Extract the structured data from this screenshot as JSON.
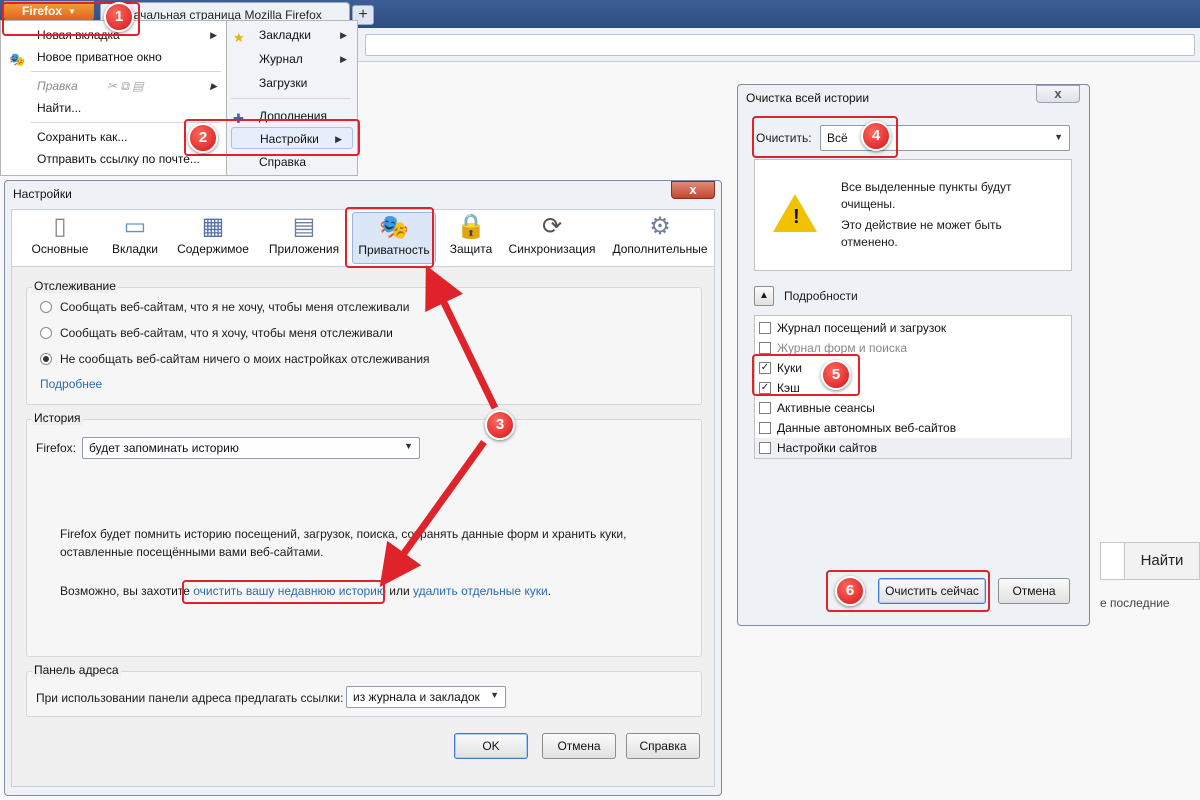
{
  "browser": {
    "menu_button": "Firefox",
    "tab_title": "Начальная страница Mozilla Firefox",
    "new_tab_symbol": "+"
  },
  "firefox_menu": {
    "left_items": [
      {
        "label": "Новая вкладка",
        "arrow": true
      },
      {
        "label": "Новое приватное окно"
      },
      {
        "label": "Правка",
        "disabled": true,
        "arrow": true
      },
      {
        "label": "Найти..."
      },
      {
        "label": "Сохранить как..."
      },
      {
        "label": "Отправить ссылку по почте..."
      }
    ],
    "right_items": [
      {
        "label": "Закладки",
        "arrow": true
      },
      {
        "label": "Журнал",
        "arrow": true
      },
      {
        "label": "Загрузки"
      },
      {
        "label": "Дополнения"
      },
      {
        "label": "Настройки",
        "arrow": true,
        "highlighted": true
      },
      {
        "label": "Справка"
      }
    ]
  },
  "settings": {
    "title": "Настройки",
    "close": "x",
    "tabs": [
      {
        "label": "Основные",
        "icon": "switch-icon"
      },
      {
        "label": "Вкладки",
        "icon": "tabs-icon"
      },
      {
        "label": "Содержимое",
        "icon": "content-icon"
      },
      {
        "label": "Приложения",
        "icon": "applications-icon"
      },
      {
        "label": "Приватность",
        "icon": "mask-icon",
        "selected": true
      },
      {
        "label": "Защита",
        "icon": "lock-icon"
      },
      {
        "label": "Синхронизация",
        "icon": "sync-icon"
      },
      {
        "label": "Дополнительные",
        "icon": "gear-icon"
      }
    ],
    "tracking": {
      "title": "Отслеживание",
      "options": [
        {
          "label": "Сообщать веб-сайтам, что я не хочу, чтобы меня отслеживали",
          "checked": false
        },
        {
          "label": "Сообщать веб-сайтам, что я хочу, чтобы меня отслеживали",
          "checked": false
        },
        {
          "label": "Не сообщать веб-сайтам ничего о моих настройках отслеживания",
          "checked": true
        }
      ],
      "more_link": "Подробнее"
    },
    "history": {
      "title": "История",
      "firefox_label": "Firefox:",
      "mode_value": "будет запоминать историю",
      "description_1": "Firefox будет помнить историю посещений, загрузок, поиска, сохранять данные форм и хранить куки,",
      "description_2": "оставленные посещёнными вами веб-сайтами.",
      "maybe_text": "Возможно, вы захотите",
      "clear_link": "очистить вашу недавнюю историю",
      "or_text": "или",
      "cookies_link": "удалить отдельные куки",
      "period": "."
    },
    "address_bar": {
      "title": "Панель адреса",
      "label": "При использовании панели адреса предлагать ссылки:",
      "value": "из журнала и закладок"
    },
    "buttons": {
      "ok": "OK",
      "cancel": "Отмена",
      "help": "Справка"
    }
  },
  "clear_history": {
    "title": "Очистка всей истории",
    "close": "x",
    "clear_label": "Очистить:",
    "range_value": "Всё",
    "warning_1": "Все выделенные пункты будут",
    "warning_2": "очищены.",
    "warning_3": "Это действие не может быть",
    "warning_4": "отменено.",
    "details_label": "Подробности",
    "items": [
      {
        "label": "Журнал посещений и загрузок",
        "checked": false
      },
      {
        "label": "Журнал форм и поиска",
        "checked": false,
        "dim": true
      },
      {
        "label": "Куки",
        "checked": true
      },
      {
        "label": "Кэш",
        "checked": true
      },
      {
        "label": "Активные сеансы",
        "checked": false
      },
      {
        "label": "Данные автономных веб-сайтов",
        "checked": false
      },
      {
        "label": "Настройки сайтов",
        "checked": false
      }
    ],
    "check_mark": "✓",
    "buttons": {
      "clear_now": "Очистить сейчас",
      "cancel": "Отмена"
    }
  },
  "background_page": {
    "search_button": "Найти",
    "text": "е последние"
  },
  "annotations": [
    "1",
    "2",
    "3",
    "4",
    "5",
    "6"
  ],
  "colors": {
    "annotation": "#d3141b",
    "link": "#2a6bb3",
    "firefox_button": "#e0601d"
  }
}
